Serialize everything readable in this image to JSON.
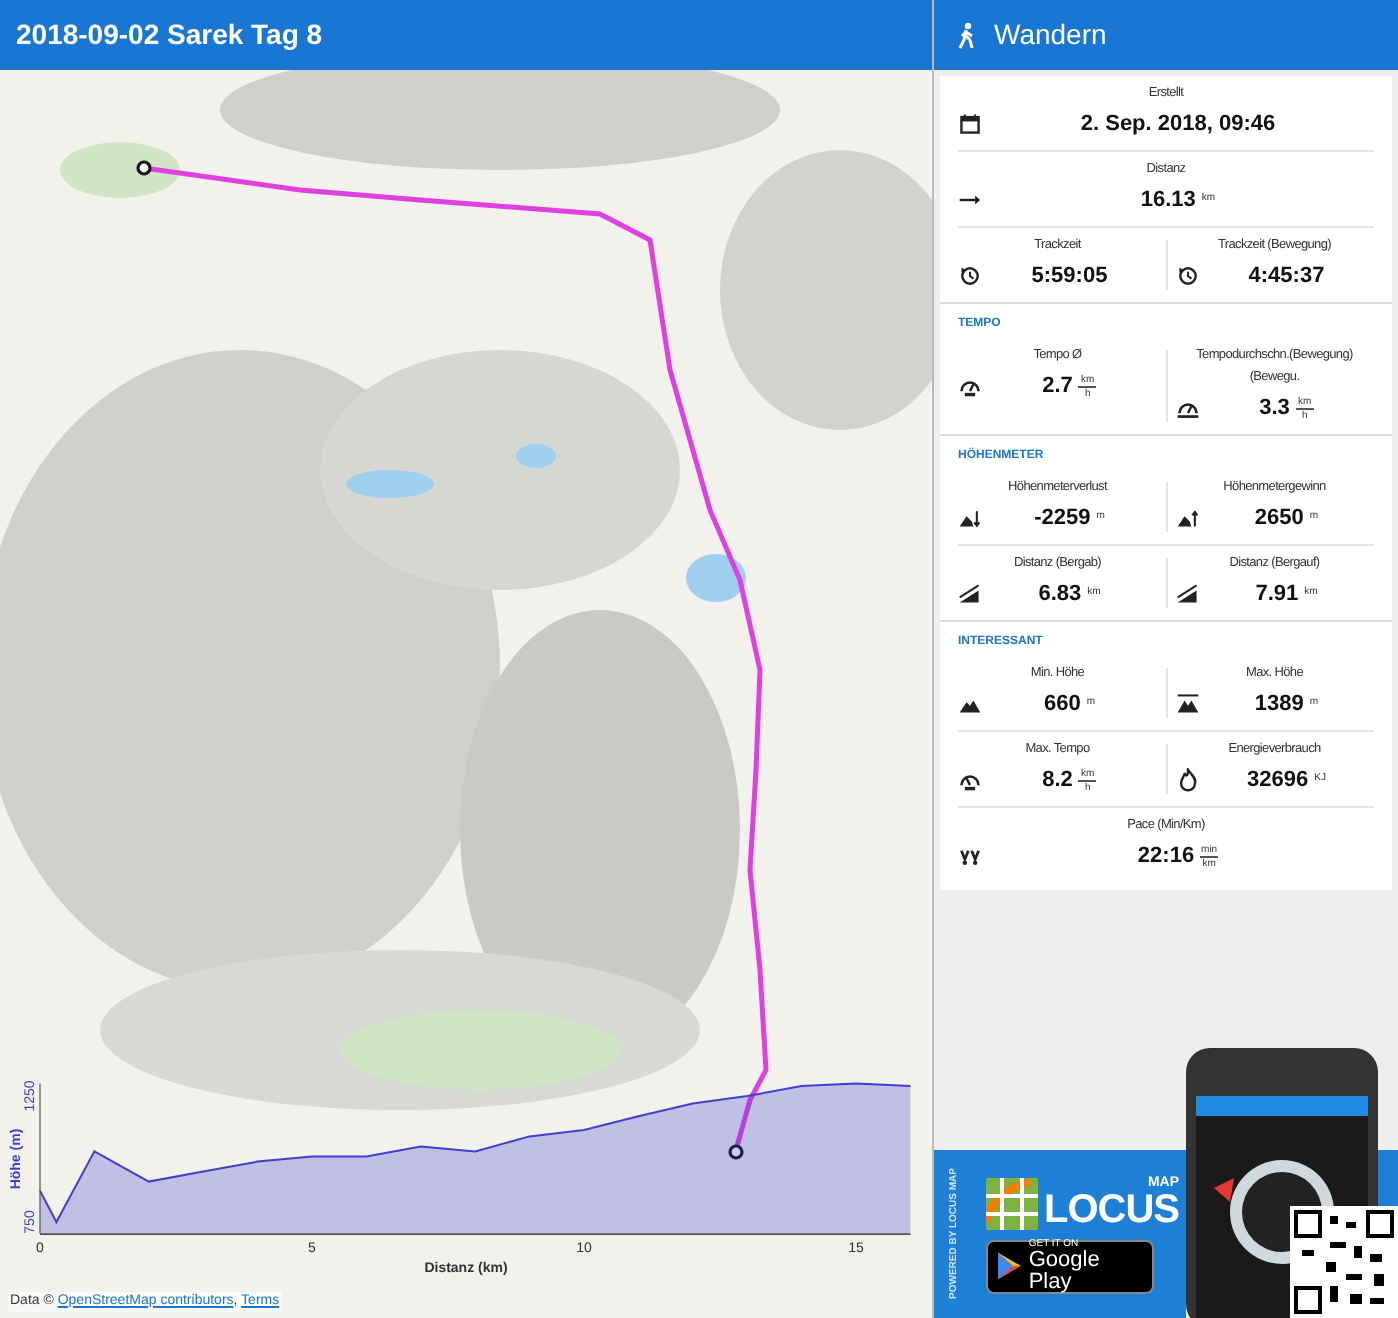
{
  "header": {
    "title": "2018-09-02 Sarek Tag 8"
  },
  "panel": {
    "title": "Wandern",
    "sections": [
      {
        "rows": [
          [
            {
              "kind": "date",
              "label": "Erstellt",
              "value": "2. Sep. 2018, 09:46"
            }
          ],
          [
            {
              "kind": "distance",
              "label": "Distanz",
              "value": "16.13",
              "unit": "km"
            }
          ],
          [
            {
              "kind": "time",
              "label": "Trackzeit",
              "value": "5:59:05"
            },
            {
              "kind": "time",
              "label": "Trackzeit (Bewegung)",
              "value": "4:45:37"
            }
          ]
        ]
      },
      {
        "heading": "TEMPO",
        "rows": [
          [
            {
              "kind": "speed",
              "label": "Tempo Ø",
              "value": "2.7",
              "unit_fraction": [
                "km",
                "h"
              ]
            },
            {
              "kind": "speed_moving",
              "label": "Tempodurchschn.(Bewegung) (Bewegu.",
              "value": "3.3",
              "unit_fraction": [
                "km",
                "h"
              ]
            }
          ]
        ]
      },
      {
        "heading": "HÖHENMETER",
        "rows": [
          [
            {
              "kind": "descent",
              "label": "Höhenmeterverlust",
              "value": "-2259",
              "unit": "m"
            },
            {
              "kind": "ascent",
              "label": "Höhenmetergewinn",
              "value": "2650",
              "unit": "m"
            }
          ],
          [
            {
              "kind": "slope",
              "label": "Distanz (Bergab)",
              "value": "6.83",
              "unit": "km"
            },
            {
              "kind": "slope",
              "label": "Distanz (Bergauf)",
              "value": "7.91",
              "unit": "km"
            }
          ]
        ]
      },
      {
        "heading": "INTERESSANT",
        "rows": [
          [
            {
              "kind": "min_alt",
              "label": "Min. Höhe",
              "value": "660",
              "unit": "m"
            },
            {
              "kind": "max_alt",
              "label": "Max. Höhe",
              "value": "1389",
              "unit": "m"
            }
          ],
          [
            {
              "kind": "speed_max",
              "label": "Max. Tempo",
              "value": "8.2",
              "unit_fraction": [
                "km",
                "h"
              ]
            },
            {
              "kind": "energy",
              "label": "Energieverbrauch",
              "value": "32696",
              "unit": "KJ"
            }
          ],
          [
            {
              "kind": "pace",
              "label": "Pace (Min/Km)",
              "value": "22:16",
              "unit_fraction": [
                "min",
                "km"
              ]
            }
          ]
        ]
      }
    ]
  },
  "profile": {
    "chart_data": {
      "type": "area",
      "xlabel": "Distanz (km)",
      "ylabel": "Höhe (m)",
      "x": [
        0,
        0.3,
        1,
        2,
        3,
        4,
        5,
        6,
        7,
        8,
        9,
        10,
        11,
        12,
        13,
        14,
        15,
        16
      ],
      "series": [
        {
          "color": "#3f3fd0",
          "values": [
            875,
            750,
            1030,
            910,
            950,
            990,
            1010,
            1010,
            1050,
            1030,
            1090,
            1115,
            1170,
            1220,
            1250,
            1290,
            1300,
            1290
          ]
        }
      ],
      "xlim": [
        0,
        16
      ],
      "ylim": [
        702,
        1300
      ],
      "xticks": [
        0,
        5,
        10,
        15
      ],
      "yticks": [
        750,
        1250
      ]
    }
  },
  "attribution": {
    "prefix": "Data ©",
    "link": "OpenStreetMap contributors",
    "separator": ",",
    "terms": "Terms"
  },
  "ad": {
    "powered": "POWERED BY LOCUS MAP",
    "logo_small": "MAP",
    "logo_big": "LOCUS",
    "store_line1": "GET IT ON",
    "store_line2": "Google Play"
  }
}
